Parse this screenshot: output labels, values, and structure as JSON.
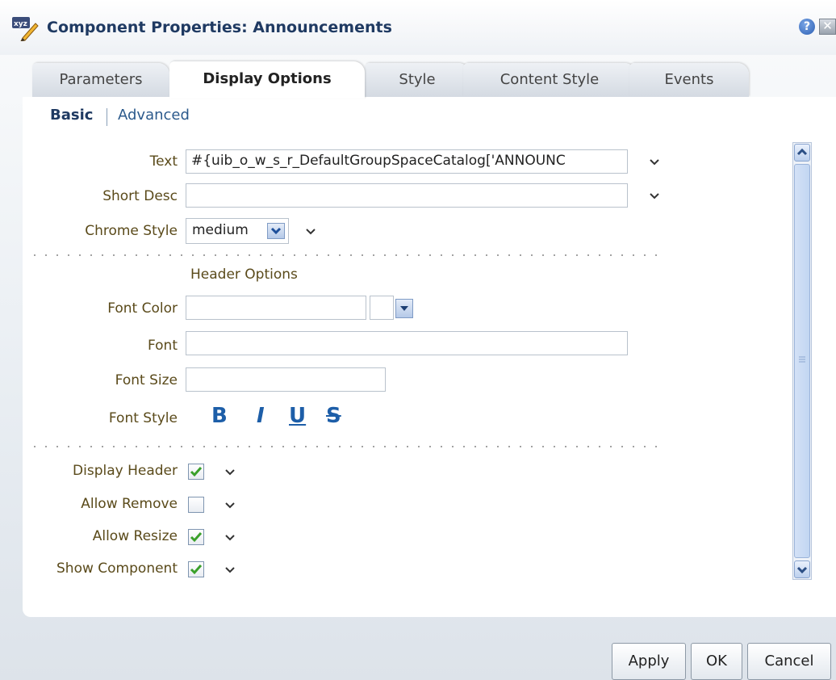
{
  "title": "Component Properties: Announcements",
  "title_icon": "xyz-edit-icon",
  "help_symbol": "?",
  "close_symbol": "✕",
  "tabs": [
    {
      "label": "Parameters"
    },
    {
      "label": "Display Options"
    },
    {
      "label": "Style"
    },
    {
      "label": "Content Style"
    },
    {
      "label": "Events"
    }
  ],
  "active_tab": "Display Options",
  "subtabs": {
    "basic": "Basic",
    "advanced": "Advanced"
  },
  "fields": {
    "text": {
      "label": "Text",
      "value": "#{uib_o_w_s_r_DefaultGroupSpaceCatalog['ANNOUNC"
    },
    "short_desc": {
      "label": "Short Desc",
      "value": ""
    },
    "chrome_style": {
      "label": "Chrome Style",
      "value": "medium"
    }
  },
  "header_options": {
    "heading": "Header Options",
    "font_color": {
      "label": "Font Color",
      "value": ""
    },
    "font": {
      "label": "Font",
      "value": ""
    },
    "font_size": {
      "label": "Font Size",
      "value": ""
    },
    "font_style": {
      "label": "Font Style",
      "bold": "B",
      "italic": "I",
      "underline": "U",
      "strike": "S"
    }
  },
  "checkboxes": [
    {
      "label": "Display Header",
      "checked": true
    },
    {
      "label": "Allow Remove",
      "checked": false
    },
    {
      "label": "Allow Resize",
      "checked": true
    },
    {
      "label": "Show Component",
      "checked": true
    }
  ],
  "buttons": {
    "apply": "Apply",
    "ok": "OK",
    "cancel": "Cancel"
  },
  "colors": {
    "accent": "#1f3a62",
    "label": "#5a4a1a",
    "check": "#3aa02a",
    "font_style": "#1d5ea8"
  }
}
